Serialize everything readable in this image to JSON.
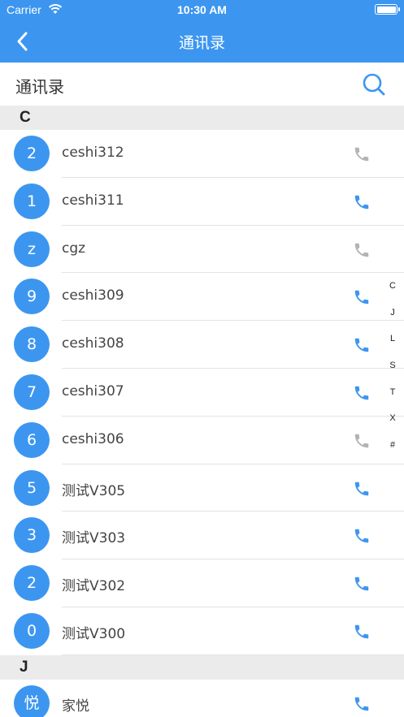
{
  "status_bar": {
    "carrier": "Carrier",
    "time": "10:30 AM"
  },
  "nav": {
    "title": "通讯录",
    "back_icon": "chevron-left-icon"
  },
  "subheader": {
    "title": "通讯录",
    "search_icon": "search-icon"
  },
  "colors": {
    "accent": "#3c96f0",
    "phone_active": "#3c96f0",
    "phone_inactive": "#b3b3b3",
    "section_bg": "#ebebeb"
  },
  "sections": [
    {
      "letter": "C",
      "contacts": [
        {
          "avatar": "2",
          "name": "ceshi312",
          "phone_active": false
        },
        {
          "avatar": "1",
          "name": "ceshi311",
          "phone_active": true
        },
        {
          "avatar": "z",
          "name": "cgz",
          "phone_active": false
        },
        {
          "avatar": "9",
          "name": "ceshi309",
          "phone_active": true
        },
        {
          "avatar": "8",
          "name": "ceshi308",
          "phone_active": true
        },
        {
          "avatar": "7",
          "name": "ceshi307",
          "phone_active": true
        },
        {
          "avatar": "6",
          "name": "ceshi306",
          "phone_active": false
        },
        {
          "avatar": "5",
          "name": "测试V305",
          "phone_active": true
        },
        {
          "avatar": "3",
          "name": "测试V303",
          "phone_active": true
        },
        {
          "avatar": "2",
          "name": "测试V302",
          "phone_active": true
        },
        {
          "avatar": "0",
          "name": "测试V300",
          "phone_active": true
        }
      ]
    },
    {
      "letter": "J",
      "contacts": [
        {
          "avatar": "悦",
          "name": "家悦",
          "phone_active": true
        }
      ]
    }
  ],
  "index_letters": [
    "C",
    "J",
    "L",
    "S",
    "T",
    "X",
    "#"
  ]
}
